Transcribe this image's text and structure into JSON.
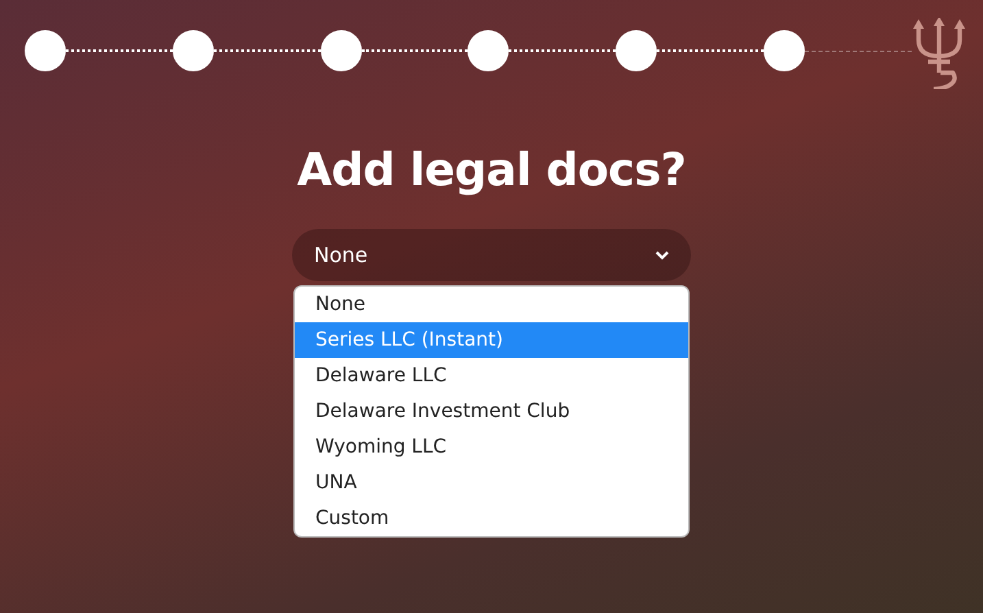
{
  "steps": [
    {
      "done": true
    },
    {
      "done": true
    },
    {
      "done": true
    },
    {
      "done": true
    },
    {
      "done": true
    },
    {
      "done": true
    }
  ],
  "title": "Add legal docs?",
  "select": {
    "value": "None",
    "expanded": true,
    "options": [
      {
        "label": "None",
        "highlighted": false
      },
      {
        "label": "Series LLC (Instant)",
        "highlighted": true
      },
      {
        "label": "Delaware LLC",
        "highlighted": false
      },
      {
        "label": "Delaware Investment Club",
        "highlighted": false
      },
      {
        "label": "Wyoming LLC",
        "highlighted": false
      },
      {
        "label": "UNA",
        "highlighted": false
      },
      {
        "label": "Custom",
        "highlighted": false
      }
    ]
  }
}
